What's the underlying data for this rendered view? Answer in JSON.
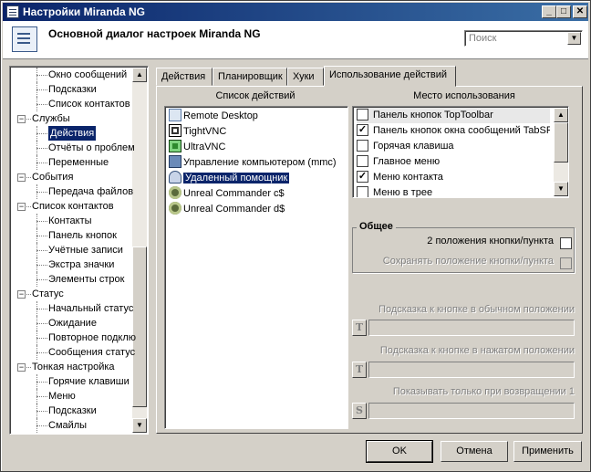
{
  "window": {
    "title": "Настройки Miranda NG",
    "minimize": "_",
    "maximize": "□",
    "close": "✕"
  },
  "header": {
    "title": "Основной диалог настроек Miranda NG",
    "search_placeholder": "Поиск"
  },
  "tree": {
    "items": [
      {
        "label": "Окно сообщений",
        "level": 2
      },
      {
        "label": "Подсказки",
        "level": 2
      },
      {
        "label": "Список контактов",
        "level": 2
      },
      {
        "label": "Службы",
        "level": 1
      },
      {
        "label": "Действия",
        "level": 2,
        "selected": true
      },
      {
        "label": "Отчёты о проблем",
        "level": 2
      },
      {
        "label": "Переменные",
        "level": 2
      },
      {
        "label": "События",
        "level": 1
      },
      {
        "label": "Передача файлов",
        "level": 2
      },
      {
        "label": "Список контактов",
        "level": 1
      },
      {
        "label": "Контакты",
        "level": 2
      },
      {
        "label": "Панель кнопок",
        "level": 2
      },
      {
        "label": "Учётные записи",
        "level": 2
      },
      {
        "label": "Экстра значки",
        "level": 2
      },
      {
        "label": "Элементы строк",
        "level": 2
      },
      {
        "label": "Статус",
        "level": 1
      },
      {
        "label": "Начальный статус",
        "level": 2
      },
      {
        "label": "Ожидание",
        "level": 2
      },
      {
        "label": "Повторное подклю",
        "level": 2
      },
      {
        "label": "Сообщения статус",
        "level": 2
      },
      {
        "label": "Тонкая настройка",
        "level": 1
      },
      {
        "label": "Горячие клавиши",
        "level": 2
      },
      {
        "label": "Меню",
        "level": 2
      },
      {
        "label": "Подсказки",
        "level": 2
      },
      {
        "label": "Смайлы",
        "level": 2
      }
    ],
    "expander_minus": "−"
  },
  "tabs": [
    {
      "label": "Действия"
    },
    {
      "label": "Планировщик"
    },
    {
      "label": "Хуки"
    },
    {
      "label": "Использование действий",
      "active": true
    }
  ],
  "actions": {
    "caption": "Список действий",
    "items": [
      {
        "label": "Remote Desktop",
        "icon": "remote-desktop-icon"
      },
      {
        "label": "TightVNC",
        "icon": "vnc-icon"
      },
      {
        "label": "UltraVNC",
        "icon": "ultravnc-icon"
      },
      {
        "label": "Управление компьютером (mmc)",
        "icon": "computer-management-icon"
      },
      {
        "label": "Удаленный помощник",
        "icon": "remote-assistant-icon",
        "selected": true
      },
      {
        "label": "Unreal Commander c$",
        "icon": "unreal-commander-icon"
      },
      {
        "label": "Unreal Commander d$",
        "icon": "unreal-commander-icon"
      }
    ]
  },
  "usage": {
    "caption": "Место использования",
    "items": [
      {
        "label": "Панель кнопок TopToolbar",
        "checked": false,
        "focused": true
      },
      {
        "label": "Панель кнопок окна сообщений TabSRMM",
        "checked": true
      },
      {
        "label": "Горячая клавиша",
        "checked": false
      },
      {
        "label": "Главное меню",
        "checked": false
      },
      {
        "label": "Меню контакта",
        "checked": true
      },
      {
        "label": "Меню в трее",
        "checked": false
      }
    ],
    "check_mark": "✓"
  },
  "general": {
    "title": "Общее",
    "two_state_label": "2 положения кнопки/пункта",
    "save_state_label": "Сохранять положение кнопки/пункта"
  },
  "hints": {
    "normal_label": "Подсказка к кнопке в обычном положении",
    "pressed_label": "Подсказка к кнопке в нажатом положении",
    "return_label": "Показывать только при возвращении 1",
    "t_button": "T",
    "s_button": "S"
  },
  "buttons": {
    "ok": "OK",
    "cancel": "Отмена",
    "apply": "Применить"
  },
  "colors": {
    "title_gradient_start": "#0a246a",
    "title_gradient_end": "#3a6ea5",
    "selection": "#0a246a",
    "face": "#d4d0c8"
  }
}
